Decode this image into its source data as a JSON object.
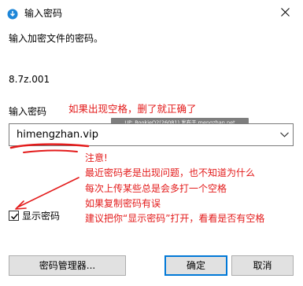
{
  "window": {
    "title": "输入密码"
  },
  "dialog": {
    "prompt": "输入加密文件的密码。",
    "file_name": "8.7z.001",
    "password_label": "输入密码",
    "password_value": "himengzhan.vip",
    "show_password_label": "显示密码",
    "show_password_checked": true
  },
  "watermark": {
    "text": "UP: RookieO2(26081) 发布于 mengzhan.net"
  },
  "annotations": {
    "hint": "如果出现空格，删了就正确了",
    "notes": [
      "注意!",
      "最近密码老是出现问题，也不知道为什么",
      "每次上传某些总是会多打一个空格",
      "如果复制密码有误",
      "建议把你“显示密码”打开，看看是否有空格"
    ],
    "color": "#e31b1b"
  },
  "buttons": {
    "manager": "密码管理器...",
    "ok": "确定",
    "cancel": "取消"
  },
  "icons": {
    "app": "key-app-icon",
    "close": "close-icon",
    "dropdown": "chevron-down-icon",
    "check": "checkmark-icon"
  }
}
